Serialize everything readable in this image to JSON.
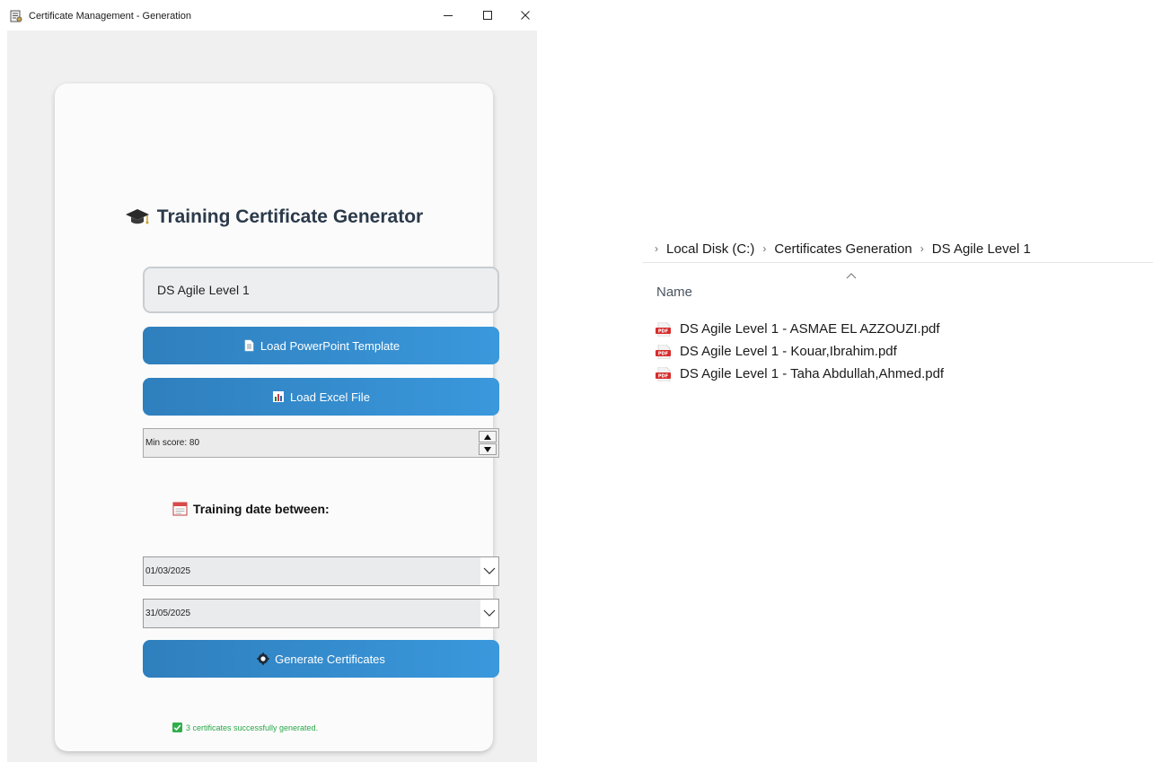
{
  "window": {
    "title": "Certificate Management - Generation",
    "controls": {
      "minimize": "minimize-icon",
      "maximize": "maximize-icon",
      "close": "close-icon"
    }
  },
  "form": {
    "heading": "Training Certificate Generator",
    "heading_icon": "graduation-cap-icon",
    "course_name_value": "DS Agile Level 1",
    "load_template_label": "Load PowerPoint Template",
    "load_template_icon": "document-icon",
    "load_excel_label": "Load Excel File",
    "load_excel_icon": "bar-chart-icon",
    "min_score_value": "Min score: 80",
    "date_section_label": "Training date between:",
    "date_section_icon": "calendar-icon",
    "date_from": "01/03/2025",
    "date_to": "31/05/2025",
    "generate_label": "Generate Certificates",
    "generate_icon": "gear-icon",
    "status_message": "3 certificates successfully generated.",
    "status_icon": "check-icon"
  },
  "explorer": {
    "breadcrumb": [
      "Local Disk (C:)",
      "Certificates Generation",
      "DS Agile Level 1"
    ],
    "column_name": "Name",
    "files": [
      {
        "name": "DS Agile Level 1 - ASMAE EL AZZOUZI.pdf",
        "icon": "pdf-icon"
      },
      {
        "name": "DS Agile Level 1 - Kouar,Ibrahim.pdf",
        "icon": "pdf-icon"
      },
      {
        "name": "DS Agile Level 1 - Taha Abdullah,Ahmed.pdf",
        "icon": "pdf-icon"
      }
    ]
  },
  "colors": {
    "button_gradient_start": "#2f7fbd",
    "button_gradient_end": "#3a98dc",
    "status_green": "#2aa84a",
    "heading_text": "#2b3a4a",
    "window_background": "#f0f0f0"
  }
}
